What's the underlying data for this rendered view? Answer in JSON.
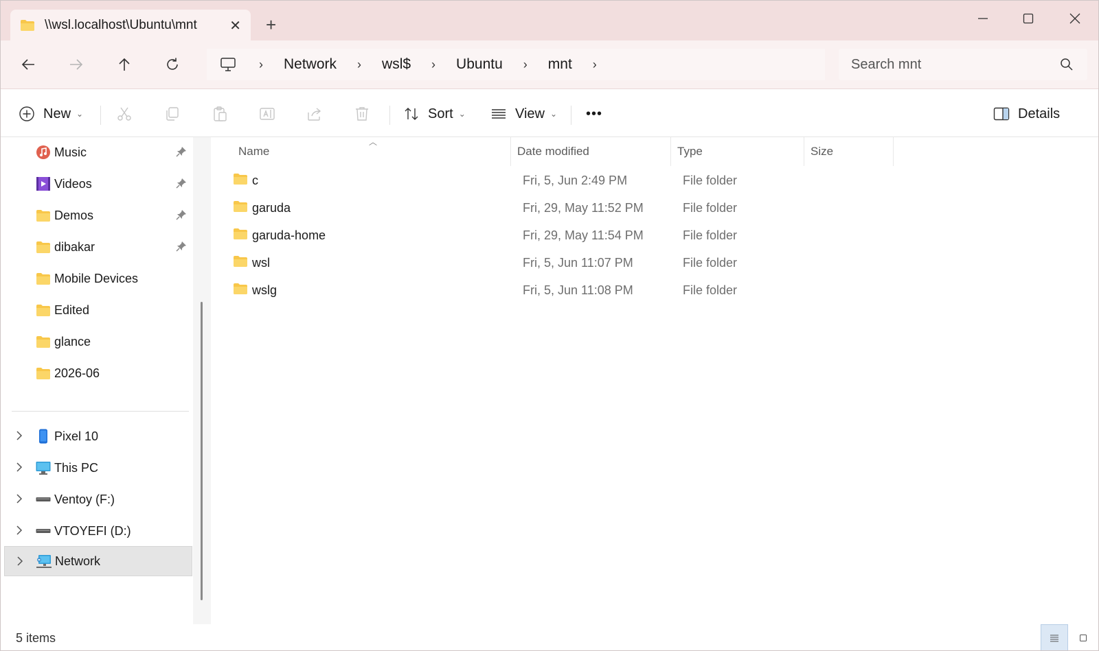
{
  "window": {
    "tab_title": "\\\\wsl.localhost\\Ubuntu\\mnt",
    "new_tab_label": "+"
  },
  "address": {
    "breadcrumb": [
      "Network",
      "wsl$",
      "Ubuntu",
      "mnt"
    ],
    "search_placeholder": "Search mnt"
  },
  "commandbar": {
    "new_label": "New",
    "sort_label": "Sort",
    "view_label": "View",
    "more_label": "•••",
    "details_label": "Details"
  },
  "sidebar": {
    "quick_access": [
      {
        "label": "Music",
        "icon": "music-icon",
        "pinned": true
      },
      {
        "label": "Videos",
        "icon": "videos-icon",
        "pinned": true
      },
      {
        "label": "Demos",
        "icon": "folder-icon",
        "pinned": true
      },
      {
        "label": "dibakar",
        "icon": "folder-icon",
        "pinned": true
      },
      {
        "label": "Mobile Devices",
        "icon": "folder-icon",
        "pinned": false
      },
      {
        "label": "Edited",
        "icon": "folder-icon",
        "pinned": false
      },
      {
        "label": "glance",
        "icon": "folder-icon",
        "pinned": false
      },
      {
        "label": "2026-06",
        "icon": "folder-icon",
        "pinned": false
      }
    ],
    "devices": [
      {
        "label": "Pixel 10",
        "icon": "phone-icon"
      },
      {
        "label": "This PC",
        "icon": "monitor-icon"
      },
      {
        "label": "Ventoy (F:)",
        "icon": "drive-icon"
      },
      {
        "label": "VTOYEFI (D:)",
        "icon": "drive-icon"
      },
      {
        "label": "Network",
        "icon": "network-icon",
        "selected": true
      }
    ]
  },
  "filelist": {
    "columns": [
      "Name",
      "Date modified",
      "Type",
      "Size"
    ],
    "rows": [
      {
        "name": "c",
        "date": "Fri, 5, Jun 2:49 PM",
        "type": "File folder"
      },
      {
        "name": "garuda",
        "date": "Fri, 29, May 11:52 PM",
        "type": "File folder"
      },
      {
        "name": "garuda-home",
        "date": "Fri, 29, May 11:54 PM",
        "type": "File folder"
      },
      {
        "name": "wsl",
        "date": "Fri, 5, Jun 11:07 PM",
        "type": "File folder"
      },
      {
        "name": "wslg",
        "date": "Fri, 5, Jun 11:08 PM",
        "type": "File folder"
      }
    ]
  },
  "status": {
    "items_count": "5 items"
  },
  "colors": {
    "titlebar_bg": "#f2dede",
    "addressbar_bg": "#faf1f1",
    "folder_yellow": "#f8c74a",
    "selection_bg": "#e5e5e5"
  }
}
